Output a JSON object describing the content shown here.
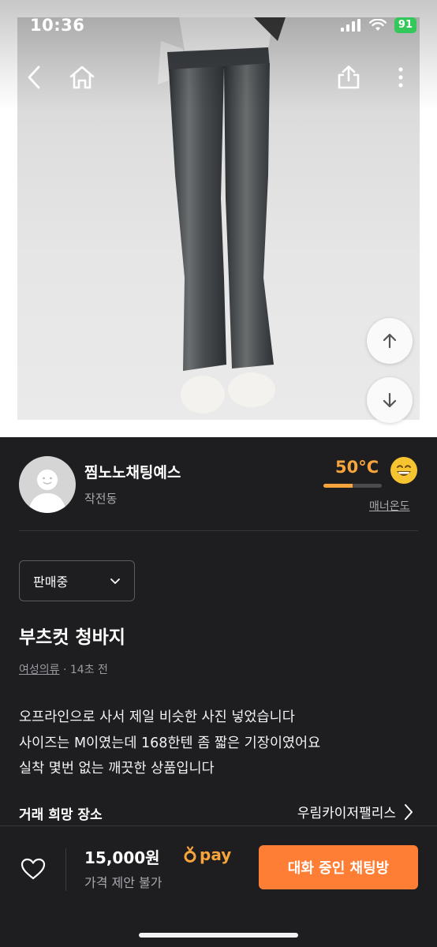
{
  "status_bar": {
    "time": "10:36",
    "battery": "91"
  },
  "nav": {
    "back_icon": "chevron-left-icon",
    "home_icon": "home-icon",
    "share_icon": "share-icon",
    "more_icon": "more-vertical-icon"
  },
  "photo_nav": {
    "up_icon": "arrow-up-icon",
    "down_icon": "arrow-down-icon"
  },
  "seller": {
    "name": "찜노노채팅예스",
    "location": "작전동",
    "temperature": "50°C",
    "temperature_level": 0.5,
    "manner_label": "매너온도",
    "colors": {
      "accent": "#f6a43b"
    }
  },
  "listing": {
    "status": "판매중",
    "title": "부츠컷 청바지",
    "category": "여성의류",
    "time_ago": "· 14초 전",
    "description": [
      "오프라인으로 사서 제일 비슷한 사진 넣었습니다",
      "사이즈는 M이였는데 168한텐 좀 짧은 기장이였어요",
      "실착 몇번 없는 깨끗한 상품입니다"
    ],
    "place_label": "거래 희망 장소",
    "place_value": "우림카이저팰리스"
  },
  "bottom": {
    "price": "15,000원",
    "pay_label": "pay",
    "negotiation": "가격 제안 불가",
    "chat_button": "대화 중인 채팅방",
    "colors": {
      "button": "#ff7e36"
    }
  }
}
